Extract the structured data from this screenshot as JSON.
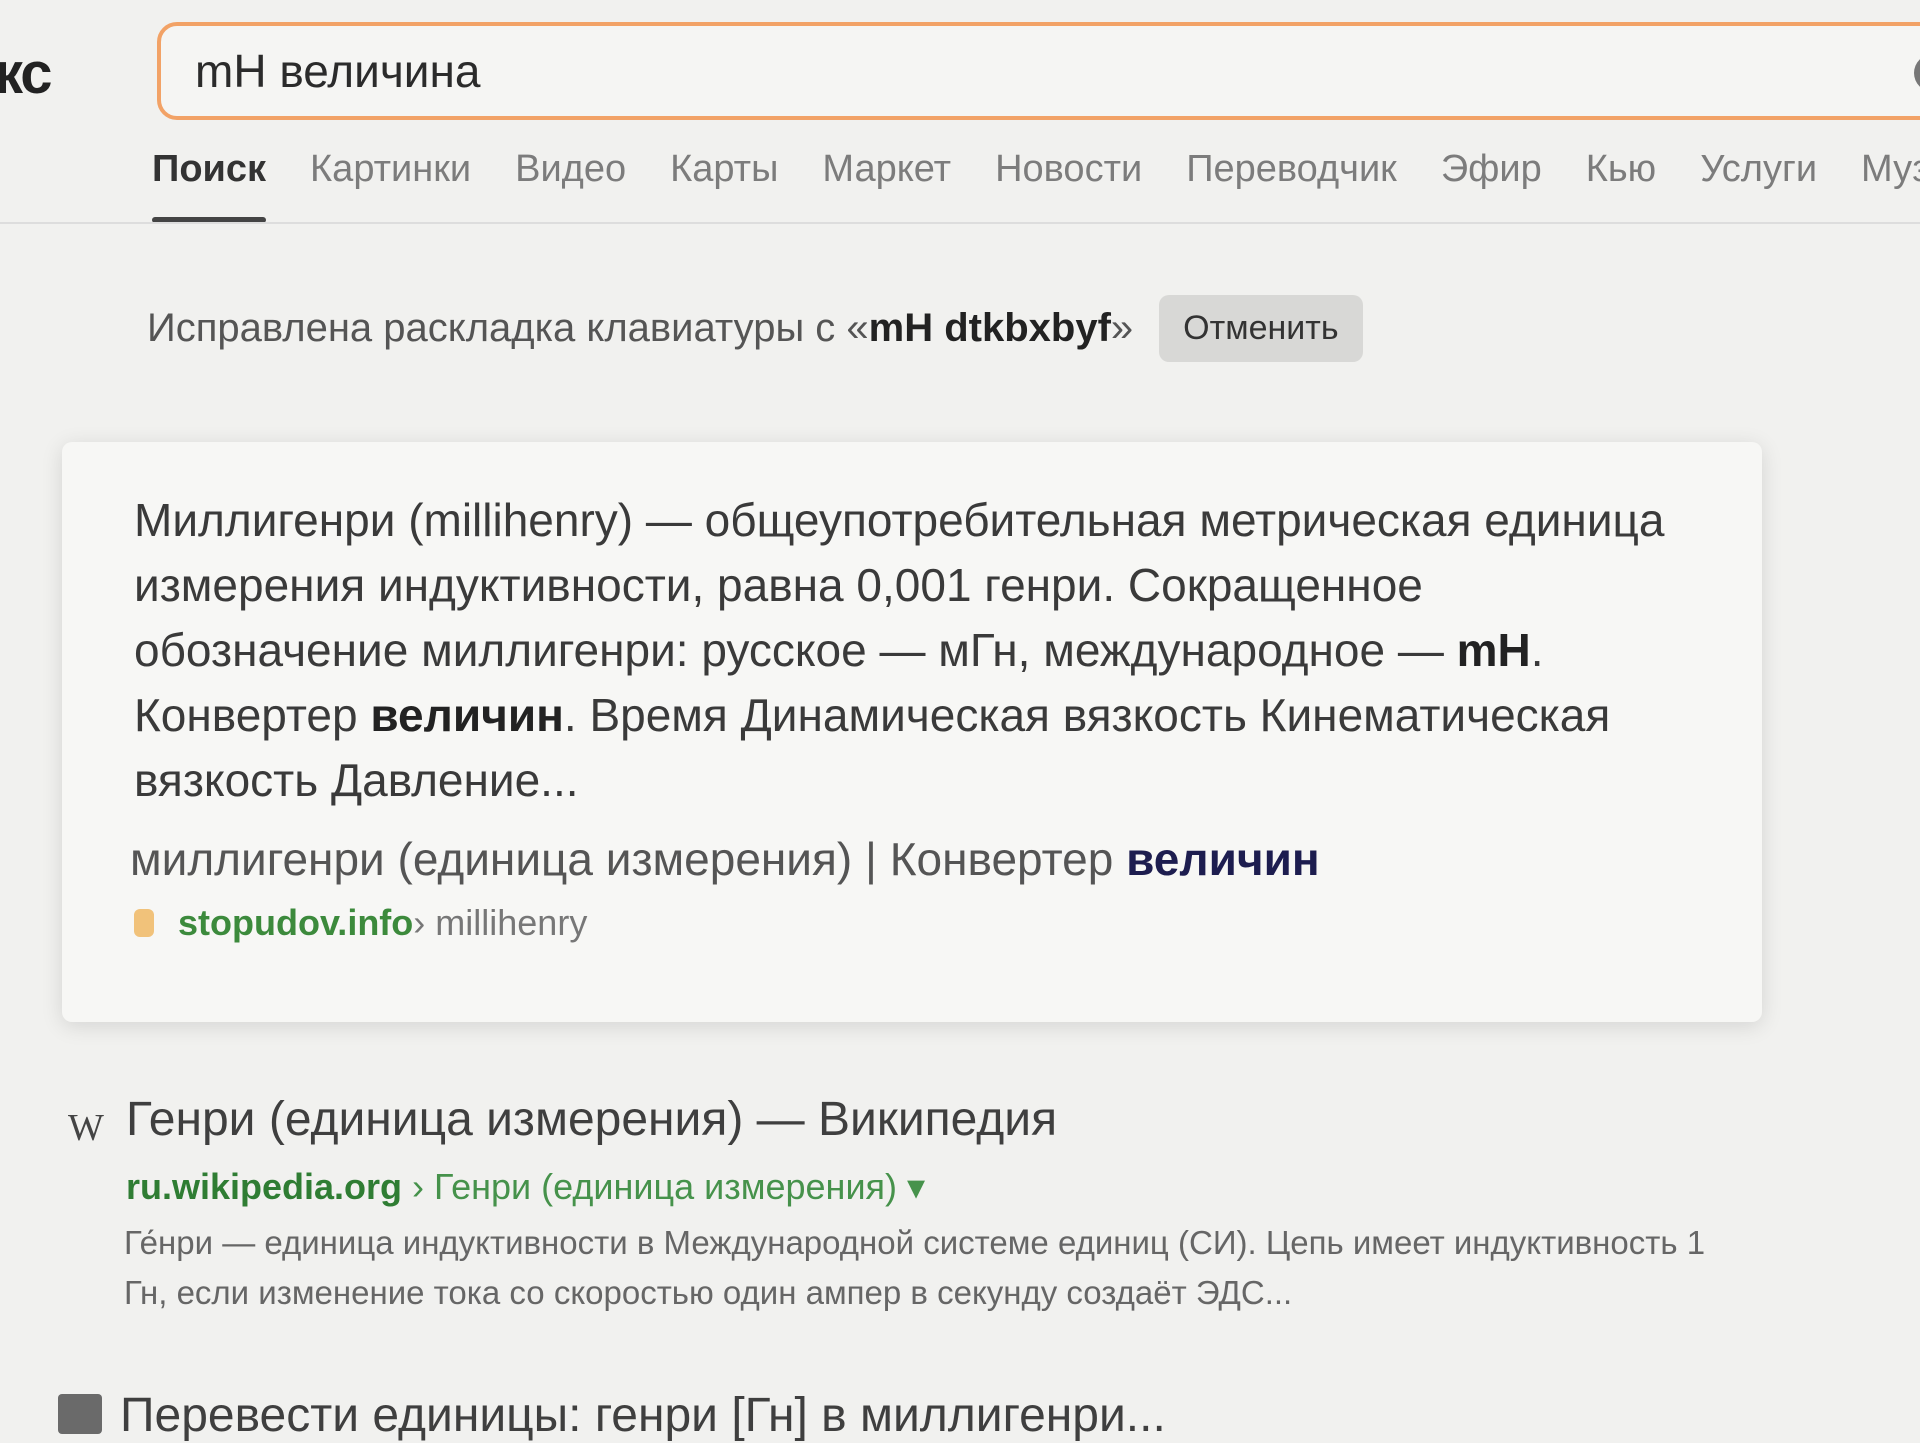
{
  "logo": {
    "text": "кс"
  },
  "search": {
    "value": "mH величина"
  },
  "tabs": [
    "Поиск",
    "Картинки",
    "Видео",
    "Карты",
    "Маркет",
    "Новости",
    "Переводчик",
    "Эфир",
    "Кью",
    "Услуги",
    "Музык"
  ],
  "layout_fix": {
    "text": "Исправлена раскладка клавиатуры с «",
    "query": "mH dtkbxbyf",
    "close_quote": "»",
    "cancel_label": "Отменить"
  },
  "snippet": {
    "p1": "Миллигенри (millihenry) — общеупотребительная метрическая единица измерения индуктивности, равна 0,001 генри. Сокращенное обозначение миллигенри: русское — мГн, международное — ",
    "b1": "mH",
    "p2": ". Конвертер ",
    "b2": "величин",
    "p3": ". Время Динамическая вязкость Кинематическая вязкость Давление...",
    "title": "миллигенри (единица измерения) | Конвертер ",
    "title_bold": "величин",
    "domain": "stopudov.info",
    "path": " › millihenry"
  },
  "result1": {
    "icon": "W",
    "title": "Генри (единица измерения) — Википедия",
    "domain": "ru.wikipedia.org",
    "path": " › Генри (единица измерения) ▾",
    "snippet": "Ге́нри — единица индуктивности в Международной системе единиц (СИ). Цепь имеет индуктивность 1 Гн, если изменение тока со скоростью один ампер в секунду создаёт ЭДС..."
  },
  "result2": {
    "title": "Перевести единицы: генри [Гн] в миллигенри..."
  }
}
